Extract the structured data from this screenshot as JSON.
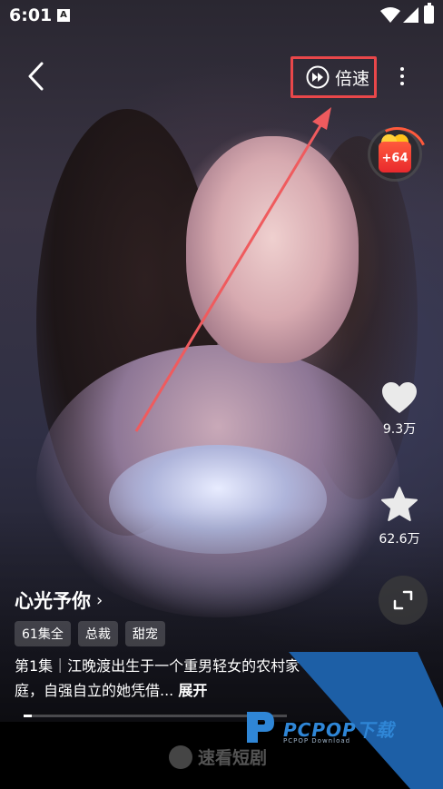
{
  "status_bar": {
    "time": "6:01",
    "notification_icon": "A"
  },
  "header": {
    "speed_label": "倍速"
  },
  "reward": {
    "count": "+64"
  },
  "actions": {
    "like_count": "9.3万",
    "favorite_count": "62.6万"
  },
  "drama": {
    "title": "心光予你",
    "chevron": "›",
    "tags": [
      "61集全",
      "总裁",
      "甜宠"
    ],
    "description": "第1集｜江晚渡出生于一个重男轻女的农村家庭，自强自立的她凭借...",
    "expand_label": "展开",
    "progress": 0.03
  },
  "footer": {
    "app_name": "速看短剧"
  },
  "watermark": {
    "brand": "PCPOP下载",
    "sub": "PCPOP Download"
  },
  "colors": {
    "highlight": "#e9474a",
    "watermark_blue": "#1d5fa6"
  }
}
